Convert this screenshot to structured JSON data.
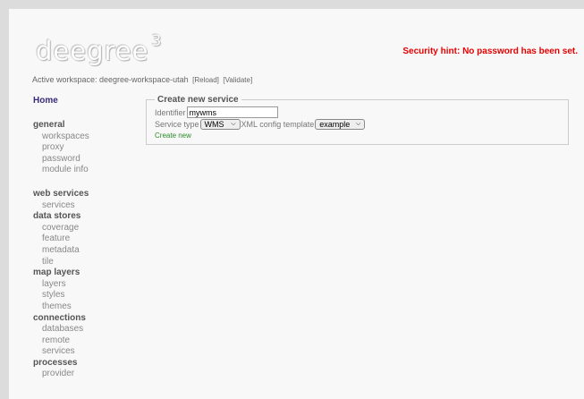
{
  "logo": {
    "text": "deegree",
    "version": "3"
  },
  "security_hint": "Security hint: No password has been set.",
  "workspace": {
    "label": "Active workspace: deegree-workspace-utah",
    "reload": "[Reload]",
    "validate": "[Validate]"
  },
  "sidebar": {
    "home": "Home",
    "general": {
      "title": "general",
      "items": [
        "workspaces",
        "proxy",
        "password",
        "module info"
      ]
    },
    "web_services": {
      "title": "web services",
      "items": [
        "services"
      ]
    },
    "data_stores": {
      "title": "data stores",
      "items": [
        "coverage",
        "feature",
        "metadata",
        "tile"
      ]
    },
    "map_layers": {
      "title": "map layers",
      "items": [
        "layers",
        "styles",
        "themes"
      ]
    },
    "connections": {
      "title": "connections",
      "items": [
        "databases",
        "remote",
        "services"
      ]
    },
    "processes": {
      "title": "processes",
      "items": [
        "provider"
      ]
    }
  },
  "form": {
    "legend": "Create new service",
    "identifier_label": "Identifier",
    "identifier_value": "mywms",
    "service_type_label": "Service type",
    "service_type_value": "WMS",
    "template_label": "XML config template",
    "template_value": "example",
    "create_link": "Create new"
  }
}
